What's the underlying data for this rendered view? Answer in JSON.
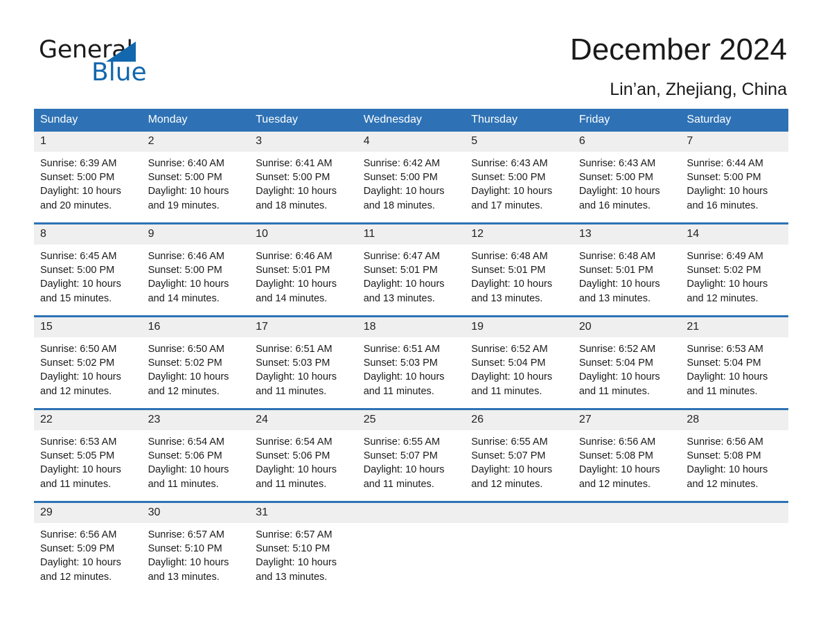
{
  "brand": {
    "name_part1": "General",
    "name_part2": "Blue",
    "triangle_icon": "triangle-logo-icon",
    "accent_color": "#1267ae"
  },
  "header": {
    "title": "December 2024",
    "location": "Lin’an, Zhejiang, China"
  },
  "colors": {
    "header_blue": "#2e72b5",
    "daynum_gray": "#efefef",
    "text": "#1a1a1a"
  },
  "calendar": {
    "weekday_headers": [
      "Sunday",
      "Monday",
      "Tuesday",
      "Wednesday",
      "Thursday",
      "Friday",
      "Saturday"
    ],
    "weeks": [
      [
        {
          "day": "1",
          "sunrise": "Sunrise: 6:39 AM",
          "sunset": "Sunset: 5:00 PM",
          "daylight_l1": "Daylight: 10 hours",
          "daylight_l2": "and 20 minutes."
        },
        {
          "day": "2",
          "sunrise": "Sunrise: 6:40 AM",
          "sunset": "Sunset: 5:00 PM",
          "daylight_l1": "Daylight: 10 hours",
          "daylight_l2": "and 19 minutes."
        },
        {
          "day": "3",
          "sunrise": "Sunrise: 6:41 AM",
          "sunset": "Sunset: 5:00 PM",
          "daylight_l1": "Daylight: 10 hours",
          "daylight_l2": "and 18 minutes."
        },
        {
          "day": "4",
          "sunrise": "Sunrise: 6:42 AM",
          "sunset": "Sunset: 5:00 PM",
          "daylight_l1": "Daylight: 10 hours",
          "daylight_l2": "and 18 minutes."
        },
        {
          "day": "5",
          "sunrise": "Sunrise: 6:43 AM",
          "sunset": "Sunset: 5:00 PM",
          "daylight_l1": "Daylight: 10 hours",
          "daylight_l2": "and 17 minutes."
        },
        {
          "day": "6",
          "sunrise": "Sunrise: 6:43 AM",
          "sunset": "Sunset: 5:00 PM",
          "daylight_l1": "Daylight: 10 hours",
          "daylight_l2": "and 16 minutes."
        },
        {
          "day": "7",
          "sunrise": "Sunrise: 6:44 AM",
          "sunset": "Sunset: 5:00 PM",
          "daylight_l1": "Daylight: 10 hours",
          "daylight_l2": "and 16 minutes."
        }
      ],
      [
        {
          "day": "8",
          "sunrise": "Sunrise: 6:45 AM",
          "sunset": "Sunset: 5:00 PM",
          "daylight_l1": "Daylight: 10 hours",
          "daylight_l2": "and 15 minutes."
        },
        {
          "day": "9",
          "sunrise": "Sunrise: 6:46 AM",
          "sunset": "Sunset: 5:00 PM",
          "daylight_l1": "Daylight: 10 hours",
          "daylight_l2": "and 14 minutes."
        },
        {
          "day": "10",
          "sunrise": "Sunrise: 6:46 AM",
          "sunset": "Sunset: 5:01 PM",
          "daylight_l1": "Daylight: 10 hours",
          "daylight_l2": "and 14 minutes."
        },
        {
          "day": "11",
          "sunrise": "Sunrise: 6:47 AM",
          "sunset": "Sunset: 5:01 PM",
          "daylight_l1": "Daylight: 10 hours",
          "daylight_l2": "and 13 minutes."
        },
        {
          "day": "12",
          "sunrise": "Sunrise: 6:48 AM",
          "sunset": "Sunset: 5:01 PM",
          "daylight_l1": "Daylight: 10 hours",
          "daylight_l2": "and 13 minutes."
        },
        {
          "day": "13",
          "sunrise": "Sunrise: 6:48 AM",
          "sunset": "Sunset: 5:01 PM",
          "daylight_l1": "Daylight: 10 hours",
          "daylight_l2": "and 13 minutes."
        },
        {
          "day": "14",
          "sunrise": "Sunrise: 6:49 AM",
          "sunset": "Sunset: 5:02 PM",
          "daylight_l1": "Daylight: 10 hours",
          "daylight_l2": "and 12 minutes."
        }
      ],
      [
        {
          "day": "15",
          "sunrise": "Sunrise: 6:50 AM",
          "sunset": "Sunset: 5:02 PM",
          "daylight_l1": "Daylight: 10 hours",
          "daylight_l2": "and 12 minutes."
        },
        {
          "day": "16",
          "sunrise": "Sunrise: 6:50 AM",
          "sunset": "Sunset: 5:02 PM",
          "daylight_l1": "Daylight: 10 hours",
          "daylight_l2": "and 12 minutes."
        },
        {
          "day": "17",
          "sunrise": "Sunrise: 6:51 AM",
          "sunset": "Sunset: 5:03 PM",
          "daylight_l1": "Daylight: 10 hours",
          "daylight_l2": "and 11 minutes."
        },
        {
          "day": "18",
          "sunrise": "Sunrise: 6:51 AM",
          "sunset": "Sunset: 5:03 PM",
          "daylight_l1": "Daylight: 10 hours",
          "daylight_l2": "and 11 minutes."
        },
        {
          "day": "19",
          "sunrise": "Sunrise: 6:52 AM",
          "sunset": "Sunset: 5:04 PM",
          "daylight_l1": "Daylight: 10 hours",
          "daylight_l2": "and 11 minutes."
        },
        {
          "day": "20",
          "sunrise": "Sunrise: 6:52 AM",
          "sunset": "Sunset: 5:04 PM",
          "daylight_l1": "Daylight: 10 hours",
          "daylight_l2": "and 11 minutes."
        },
        {
          "day": "21",
          "sunrise": "Sunrise: 6:53 AM",
          "sunset": "Sunset: 5:04 PM",
          "daylight_l1": "Daylight: 10 hours",
          "daylight_l2": "and 11 minutes."
        }
      ],
      [
        {
          "day": "22",
          "sunrise": "Sunrise: 6:53 AM",
          "sunset": "Sunset: 5:05 PM",
          "daylight_l1": "Daylight: 10 hours",
          "daylight_l2": "and 11 minutes."
        },
        {
          "day": "23",
          "sunrise": "Sunrise: 6:54 AM",
          "sunset": "Sunset: 5:06 PM",
          "daylight_l1": "Daylight: 10 hours",
          "daylight_l2": "and 11 minutes."
        },
        {
          "day": "24",
          "sunrise": "Sunrise: 6:54 AM",
          "sunset": "Sunset: 5:06 PM",
          "daylight_l1": "Daylight: 10 hours",
          "daylight_l2": "and 11 minutes."
        },
        {
          "day": "25",
          "sunrise": "Sunrise: 6:55 AM",
          "sunset": "Sunset: 5:07 PM",
          "daylight_l1": "Daylight: 10 hours",
          "daylight_l2": "and 11 minutes."
        },
        {
          "day": "26",
          "sunrise": "Sunrise: 6:55 AM",
          "sunset": "Sunset: 5:07 PM",
          "daylight_l1": "Daylight: 10 hours",
          "daylight_l2": "and 12 minutes."
        },
        {
          "day": "27",
          "sunrise": "Sunrise: 6:56 AM",
          "sunset": "Sunset: 5:08 PM",
          "daylight_l1": "Daylight: 10 hours",
          "daylight_l2": "and 12 minutes."
        },
        {
          "day": "28",
          "sunrise": "Sunrise: 6:56 AM",
          "sunset": "Sunset: 5:08 PM",
          "daylight_l1": "Daylight: 10 hours",
          "daylight_l2": "and 12 minutes."
        }
      ],
      [
        {
          "day": "29",
          "sunrise": "Sunrise: 6:56 AM",
          "sunset": "Sunset: 5:09 PM",
          "daylight_l1": "Daylight: 10 hours",
          "daylight_l2": "and 12 minutes."
        },
        {
          "day": "30",
          "sunrise": "Sunrise: 6:57 AM",
          "sunset": "Sunset: 5:10 PM",
          "daylight_l1": "Daylight: 10 hours",
          "daylight_l2": "and 13 minutes."
        },
        {
          "day": "31",
          "sunrise": "Sunrise: 6:57 AM",
          "sunset": "Sunset: 5:10 PM",
          "daylight_l1": "Daylight: 10 hours",
          "daylight_l2": "and 13 minutes."
        },
        {
          "day": "",
          "sunrise": "",
          "sunset": "",
          "daylight_l1": "",
          "daylight_l2": ""
        },
        {
          "day": "",
          "sunrise": "",
          "sunset": "",
          "daylight_l1": "",
          "daylight_l2": ""
        },
        {
          "day": "",
          "sunrise": "",
          "sunset": "",
          "daylight_l1": "",
          "daylight_l2": ""
        },
        {
          "day": "",
          "sunrise": "",
          "sunset": "",
          "daylight_l1": "",
          "daylight_l2": ""
        }
      ]
    ]
  }
}
